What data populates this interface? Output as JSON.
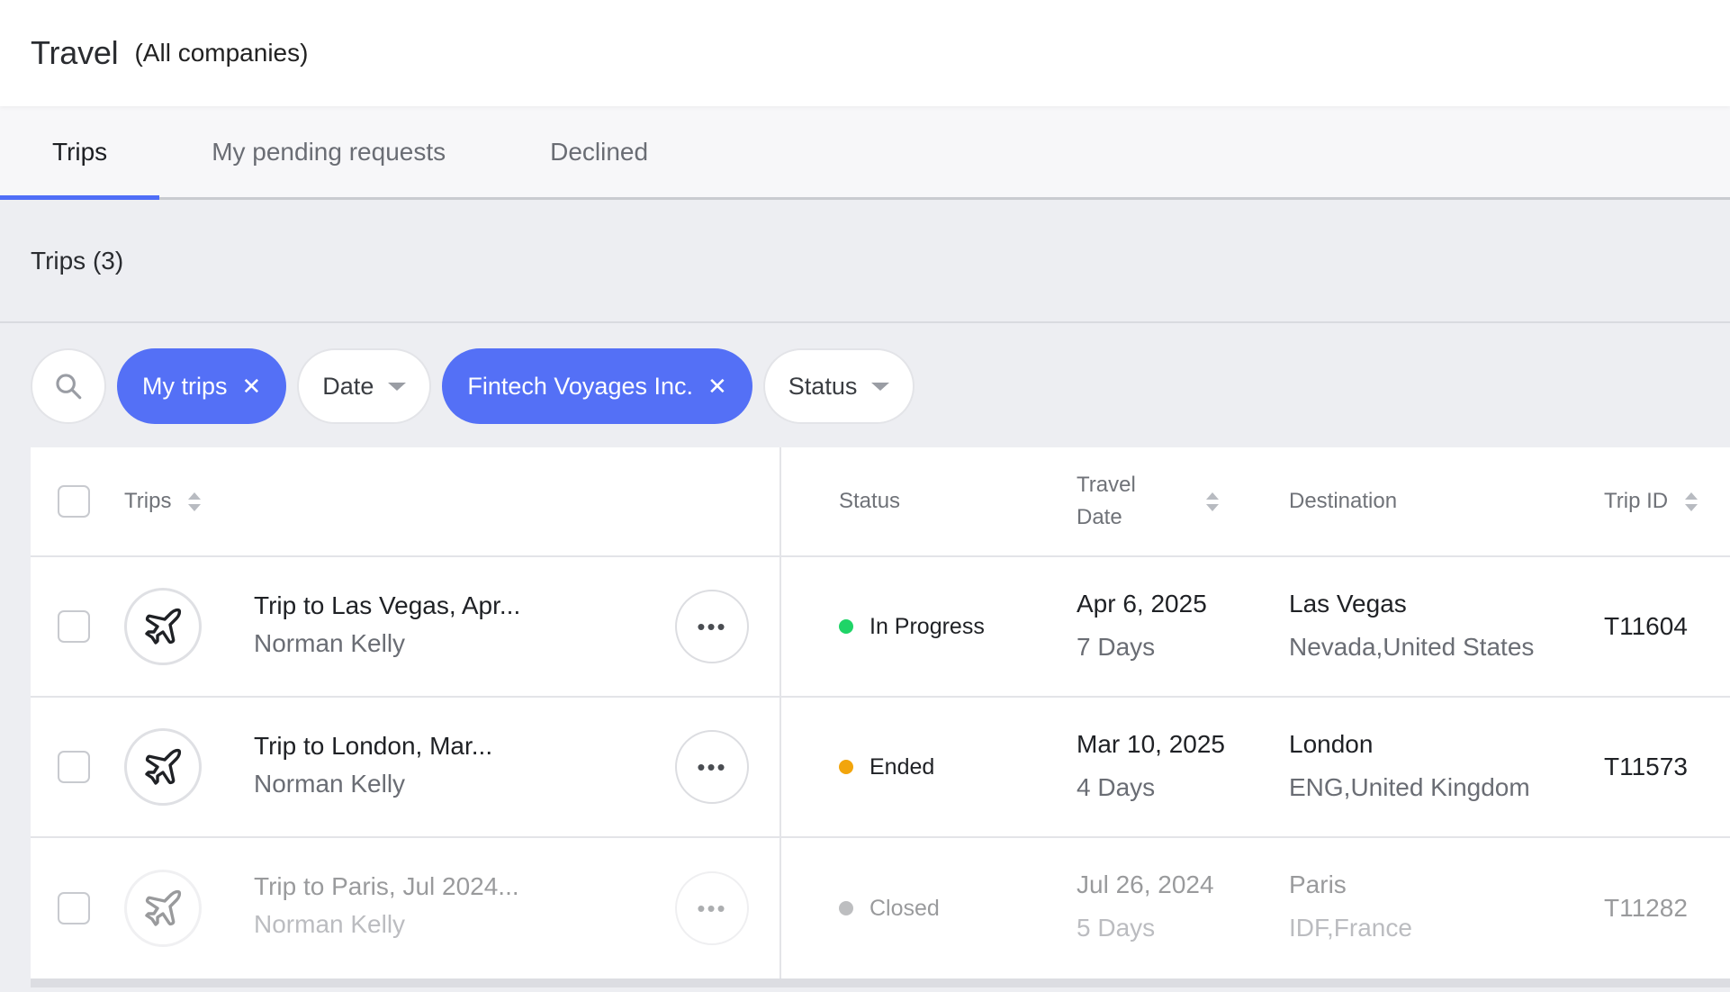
{
  "header": {
    "title": "Travel",
    "subtitle": "(All companies)"
  },
  "tabs": [
    {
      "label": "Trips",
      "active": true
    },
    {
      "label": "My pending requests",
      "active": false
    },
    {
      "label": "Declined",
      "active": false
    }
  ],
  "section": {
    "count_label": "Trips (3)"
  },
  "filters": [
    {
      "label": "My trips",
      "active": true,
      "removable": true
    },
    {
      "label": "Date",
      "active": false,
      "dropdown": true
    },
    {
      "label": "Fintech Voyages Inc.",
      "active": true,
      "removable": true
    },
    {
      "label": "Status",
      "active": false,
      "dropdown": true
    }
  ],
  "table": {
    "headers": {
      "trips": "Trips",
      "status": "Status",
      "travel_date_line1": "Travel",
      "travel_date_line2": "Date",
      "destination": "Destination",
      "trip_id": "Trip ID"
    },
    "rows": [
      {
        "name": "Trip to Las Vegas, Apr...",
        "owner": "Norman Kelly",
        "status": "In Progress",
        "status_color": "#1fd467",
        "date": "Apr 6, 2025",
        "duration": "7 Days",
        "city": "Las Vegas",
        "region": "Nevada,United States",
        "id": "T11604"
      },
      {
        "name": "Trip to London, Mar...",
        "owner": "Norman Kelly",
        "status": "Ended",
        "status_color": "#f2a50c",
        "date": "Mar 10, 2025",
        "duration": "4 Days",
        "city": "London",
        "region": "ENG,United Kingdom",
        "id": "T11573"
      },
      {
        "name": "Trip to Paris, Jul 2024...",
        "owner": "Norman Kelly",
        "status": "Closed",
        "status_color": "#9a9ca1",
        "date": "Jul 26, 2024",
        "duration": "5 Days",
        "city": "Paris",
        "region": "IDF,France",
        "id": "T11282"
      }
    ]
  },
  "colors": {
    "accent": "#5470f6",
    "background": "#edeef2"
  },
  "icons": {
    "search": "search-icon",
    "trip": "airplane-icon",
    "more": "more-icon"
  }
}
